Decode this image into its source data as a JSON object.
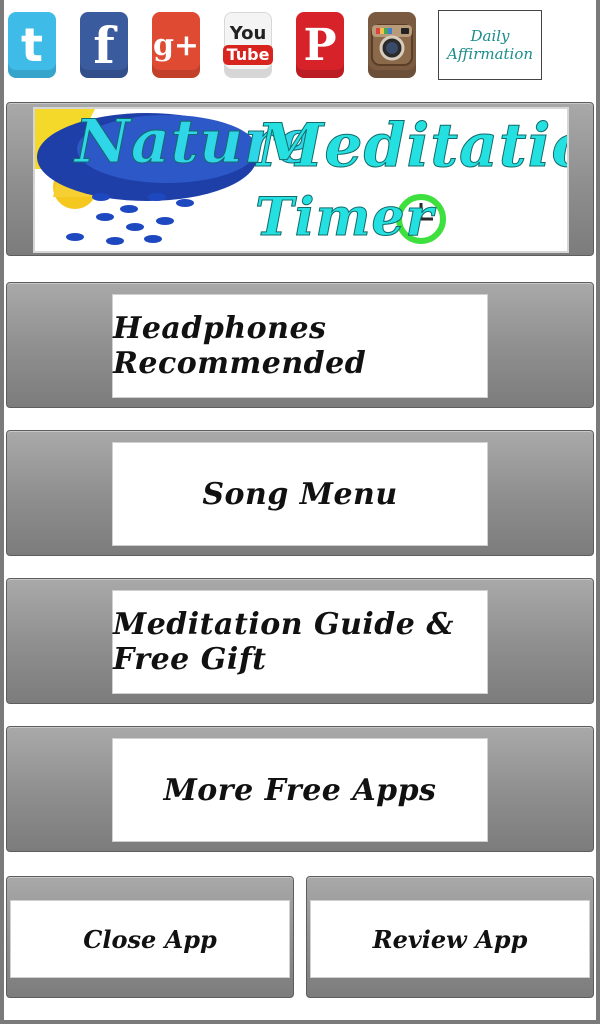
{
  "social": {
    "icons": [
      {
        "name": "twitter-icon",
        "glyph": "t"
      },
      {
        "name": "facebook-icon",
        "glyph": "f"
      },
      {
        "name": "google-plus-icon",
        "glyph": "g+"
      },
      {
        "name": "youtube-icon",
        "glyph_top": "You",
        "glyph_bottom": "Tube"
      },
      {
        "name": "pinterest-icon",
        "glyph": "P"
      },
      {
        "name": "instagram-icon",
        "glyph": ""
      }
    ],
    "affirmation": {
      "line1": "Daily",
      "line2": "Affirmation"
    }
  },
  "banner": {
    "line1a": "Nature",
    "line1b": "Meditation",
    "line2": "Timer"
  },
  "menu": {
    "headphones": "Headphones Recommended",
    "song_menu": "Song Menu",
    "guide": "Meditation Guide & Free Gift",
    "more_apps": "More Free Apps"
  },
  "footer": {
    "close": "Close App",
    "review": "Review App"
  },
  "colors": {
    "panel_gray": "#8e8e8e",
    "accent_cyan": "#25e0e0",
    "affirmation_teal": "#1c8c8c"
  }
}
